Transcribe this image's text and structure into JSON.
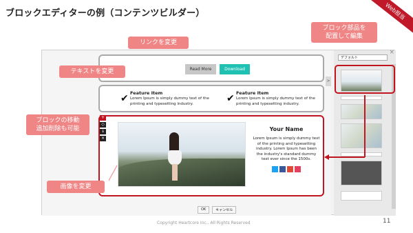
{
  "slide": {
    "title": "ブロックエディターの例（コンテンツビルダー）",
    "ribbon": "Web担当",
    "footer": "Copyright Heartcore Inc., All Rights Reserved",
    "page_number": "11"
  },
  "callouts": {
    "link": "リンクを変更",
    "text": "テキストを変更",
    "move": "ブロックの移動\n追加削除も可能",
    "image": "画像を変更",
    "parts": "ブロック部品を\n配置して編集"
  },
  "editor": {
    "close": "×",
    "buttons": {
      "read_more": "Read More",
      "download": "Download"
    },
    "features": [
      {
        "title": "Feature Item",
        "text": "Lorem Ipsum is simply dummy text of the printing and typesetting industry."
      },
      {
        "title": "Feature Item",
        "text": "Lorem Ipsum is simply dummy text of the printing and typesetting industry."
      }
    ],
    "profile": {
      "name": "Your Name",
      "text": "Lorem Ipsum is simply dummy text of the printing and typesetting industry. Lorem Ipsum has been the industry's standard dummy text ever since the 1500s."
    },
    "social_colors": [
      "#1da1f2",
      "#3b5998",
      "#dd4b39",
      "#e4405f"
    ],
    "tools": [
      "+",
      "◇",
      "↓",
      "×"
    ],
    "left_arrow": ">",
    "dialog": {
      "ok": "OK",
      "cancel": "キャンセル"
    }
  },
  "panel": {
    "select_value": "デフォルト"
  },
  "colors": {
    "accent_red": "#c0141e",
    "callout_pink": "#f08585",
    "download_teal": "#1fc2b2"
  }
}
